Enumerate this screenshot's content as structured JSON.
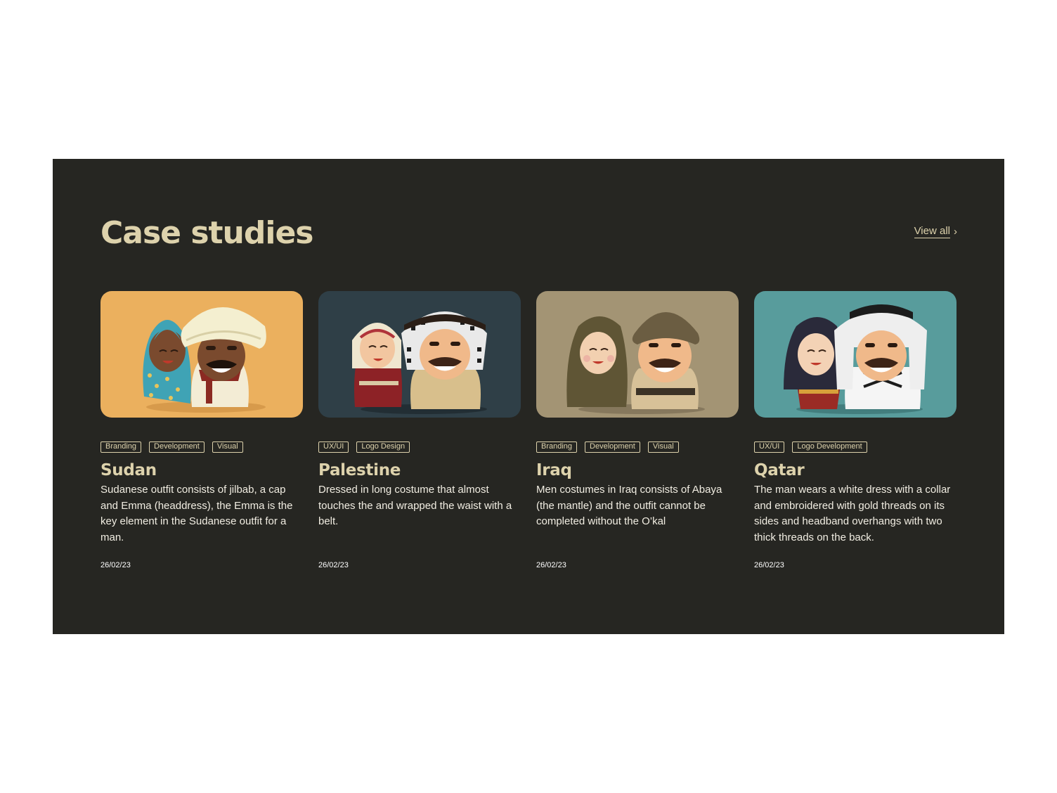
{
  "section": {
    "title": "Case studies",
    "view_all_label": "View all",
    "chevron": "›"
  },
  "cards": [
    {
      "title": "Sudan",
      "tags": [
        "Branding",
        "Development",
        "Visual"
      ],
      "description": "Sudanese outfit consists of jilbab, a cap and Emma (headdress), the Emma is the key element in the Sudanese outfit for a man.",
      "date": "26/02/23",
      "thumb_bg": "#ebb05e"
    },
    {
      "title": "Palestine",
      "tags": [
        "UX/UI",
        "Logo Design"
      ],
      "description": "Dressed in long costume that almost touches the and wrapped the waist with a belt.",
      "date": "26/02/23",
      "thumb_bg": "#2f3f47"
    },
    {
      "title": "Iraq",
      "tags": [
        "Branding",
        "Development",
        "Visual"
      ],
      "description": "Men costumes in Iraq consists of Abaya (the mantle) and the outfit cannot be completed without the O’kal",
      "date": "26/02/23",
      "thumb_bg": "#a39474"
    },
    {
      "title": "Qatar",
      "tags": [
        "UX/UI",
        "Logo Development"
      ],
      "description": "The man wears a white dress with a collar and embroidered with gold threads on its sides and headband overhangs with two thick threads on the back.",
      "date": "26/02/23",
      "thumb_bg": "#589c9c"
    }
  ],
  "colors": {
    "panel_bg": "#262622",
    "accent": "#ddd2ac",
    "body_text": "#f1ede2"
  }
}
